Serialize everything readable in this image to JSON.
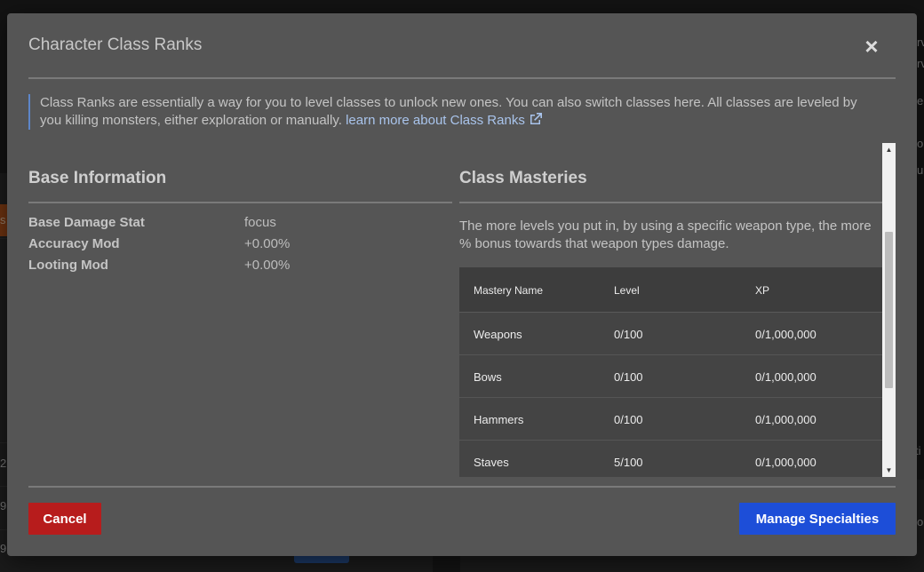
{
  "background": {
    "fragments": [
      "rv",
      "rv",
      "e",
      "o",
      "u",
      "s",
      "ti",
      "o",
      "2",
      "9,",
      "9,"
    ]
  },
  "modal": {
    "title": "Character Class Ranks",
    "close_label": "×",
    "info": {
      "text": "Class Ranks are essentially a way for you to level classes to unlock new ones. You can also switch classes here. All classes are leveled by you killing monsters, either exploration or manually. ",
      "link_text": "learn more about Class Ranks"
    },
    "base_information": {
      "title": "Base Information",
      "stats": [
        {
          "label": "Base Damage Stat",
          "value": "focus"
        },
        {
          "label": "Accuracy Mod",
          "value": "+0.00%"
        },
        {
          "label": "Looting Mod",
          "value": "+0.00%"
        }
      ]
    },
    "class_masteries": {
      "title": "Class Masteries",
      "description": "The more levels you put in, by using a specific weapon type, the more % bonus towards that weapon types damage.",
      "columns": [
        "Mastery Name",
        "Level",
        "XP"
      ],
      "rows": [
        {
          "name": "Weapons",
          "level": "0/100",
          "xp": "0/1,000,000"
        },
        {
          "name": "Bows",
          "level": "0/100",
          "xp": "0/1,000,000"
        },
        {
          "name": "Hammers",
          "level": "0/100",
          "xp": "0/1,000,000"
        },
        {
          "name": "Staves",
          "level": "5/100",
          "xp": "0/1,000,000"
        }
      ]
    },
    "buttons": {
      "cancel": "Cancel",
      "manage": "Manage Specialties"
    }
  },
  "colors": {
    "cancel": "#b71c1c",
    "primary": "#1d4ed8",
    "link": "#a9c4ec",
    "info_border": "#5d86c9"
  }
}
